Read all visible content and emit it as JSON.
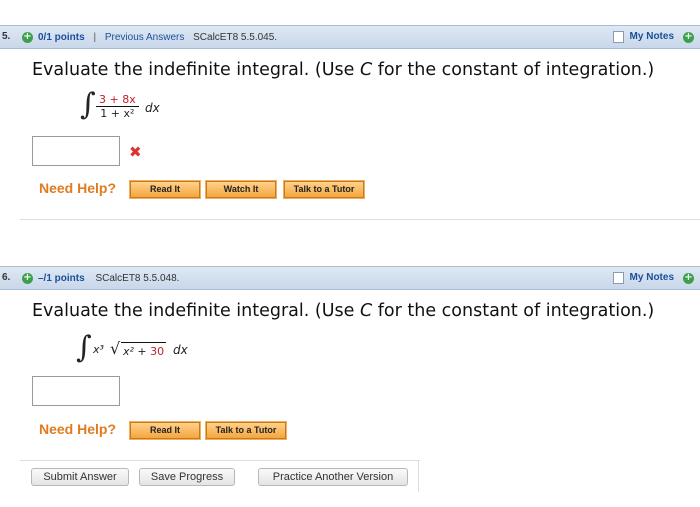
{
  "questions": [
    {
      "number": "5.",
      "points": "0/1 points",
      "separator": "|",
      "previous_answers": "Previous Answers",
      "code": "SCalcET8 5.5.045.",
      "my_notes": "My Notes",
      "prompt_before": "Evaluate the indefinite integral. (Use ",
      "prompt_var": "C",
      "prompt_after": " for the constant of integration.)",
      "integral_numerator": "3 + 8x",
      "integral_denominator": "1 + x²",
      "integral_dx": "dx",
      "status_icon": "x-icon",
      "status_glyph": "✖",
      "need_help": "Need Help?",
      "help_buttons": [
        "Read It",
        "Watch It",
        "Talk to a Tutor"
      ]
    },
    {
      "number": "6.",
      "points": "–/1 points",
      "code": "SCalcET8 5.5.048.",
      "my_notes": "My Notes",
      "prompt_before": "Evaluate the indefinite integral. (Use ",
      "prompt_var": "C",
      "prompt_after": " for the constant of integration.)",
      "integral_term": "x³",
      "integral_radicand_a": "x² + ",
      "integral_radicand_b": "30",
      "integral_dx": "dx",
      "need_help": "Need Help?",
      "help_buttons": [
        "Read It",
        "Talk to a Tutor"
      ]
    }
  ],
  "footer": {
    "submit": "Submit Answer",
    "save": "Save Progress",
    "practice": "Practice Another Version"
  },
  "colors": {
    "link_blue": "#1b4f9a",
    "help_orange": "#e07b1f",
    "error_red": "#d33333",
    "plus_green": "#3aa14a"
  }
}
